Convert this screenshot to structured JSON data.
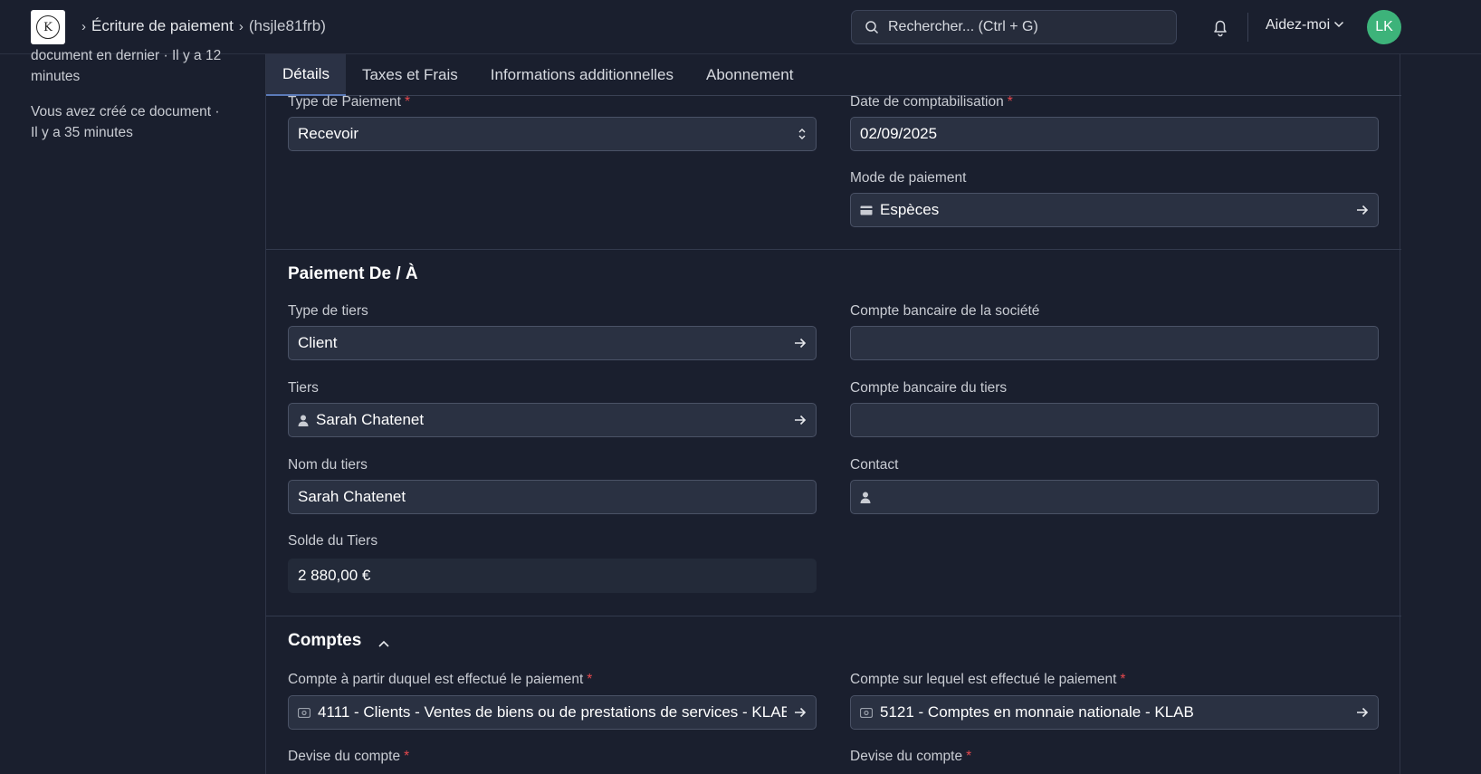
{
  "nav": {
    "breadcrumb_page": "Écriture de paiement",
    "breadcrumb_doc": "(hsjle81frb)",
    "search_placeholder": "Rechercher... (Ctrl + G)",
    "help_label": "Aidez-moi",
    "avatar_initials": "LK"
  },
  "activity": [
    "document en dernier · Il y a 12 minutes",
    "Vous avez créé ce document · Il y a 35 minutes"
  ],
  "tabs": [
    "Détails",
    "Taxes et Frais",
    "Informations additionnelles",
    "Abonnement"
  ],
  "fields": {
    "payment_type": {
      "label": "Type de Paiement",
      "value": "Recevoir"
    },
    "posting_date": {
      "label": "Date de comptabilisation",
      "value": "02/09/2025"
    },
    "payment_mode": {
      "label": "Mode de paiement",
      "value": "Espèces"
    },
    "party_type": {
      "label": "Type de tiers",
      "value": "Client"
    },
    "company_bank": {
      "label": "Compte bancaire de la société",
      "value": ""
    },
    "party": {
      "label": "Tiers",
      "value": "Sarah Chatenet"
    },
    "party_bank": {
      "label": "Compte bancaire du tiers",
      "value": ""
    },
    "party_name": {
      "label": "Nom du tiers",
      "value": "Sarah Chatenet"
    },
    "contact": {
      "label": "Contact",
      "value": ""
    },
    "party_balance": {
      "label": "Solde du Tiers",
      "value": "2 880,00 €"
    },
    "paid_from": {
      "label": "Compte à partir duquel est effectué le paiement",
      "value": "4111 - Clients - Ventes de biens ou de prestations de services - KLAB"
    },
    "paid_to": {
      "label": "Compte sur lequel est effectué le paiement",
      "value": "5121 - Comptes en monnaie nationale - KLAB"
    },
    "currency_from": {
      "label": "Devise du compte"
    },
    "currency_to": {
      "label": "Devise du compte"
    }
  },
  "sections": {
    "party_section": "Paiement De / À",
    "accounts_section": "Comptes"
  },
  "required_mark": "*"
}
